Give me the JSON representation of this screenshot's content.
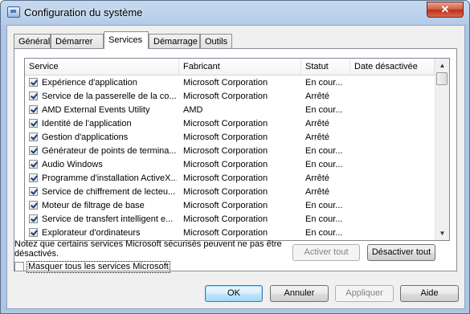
{
  "window": {
    "title": "Configuration du système",
    "close_glyph": "✕"
  },
  "tabs": [
    {
      "label": "Général"
    },
    {
      "label": "Démarrer"
    },
    {
      "label": "Services"
    },
    {
      "label": "Démarrage"
    },
    {
      "label": "Outils"
    }
  ],
  "active_tab": "Services",
  "columns": {
    "service": "Service",
    "manufacturer": "Fabricant",
    "status": "Statut",
    "disabled_date": "Date désactivée"
  },
  "services": [
    {
      "checked": true,
      "name": "Expérience d'application",
      "manufacturer": "Microsoft Corporation",
      "status": "En cour...",
      "date": ""
    },
    {
      "checked": true,
      "name": "Service de la passerelle de la co...",
      "manufacturer": "Microsoft Corporation",
      "status": "Arrêté",
      "date": ""
    },
    {
      "checked": true,
      "name": "AMD External Events Utility",
      "manufacturer": "AMD",
      "status": "En cour...",
      "date": ""
    },
    {
      "checked": true,
      "name": "Identité de l'application",
      "manufacturer": "Microsoft Corporation",
      "status": "Arrêté",
      "date": ""
    },
    {
      "checked": true,
      "name": "Gestion d'applications",
      "manufacturer": "Microsoft Corporation",
      "status": "Arrêté",
      "date": ""
    },
    {
      "checked": true,
      "name": "Générateur de points de termina...",
      "manufacturer": "Microsoft Corporation",
      "status": "En cour...",
      "date": ""
    },
    {
      "checked": true,
      "name": "Audio Windows",
      "manufacturer": "Microsoft Corporation",
      "status": "En cour...",
      "date": ""
    },
    {
      "checked": true,
      "name": "Programme d'installation ActiveX...",
      "manufacturer": "Microsoft Corporation",
      "status": "Arrêté",
      "date": ""
    },
    {
      "checked": true,
      "name": "Service de chiffrement de lecteu...",
      "manufacturer": "Microsoft Corporation",
      "status": "Arrêté",
      "date": ""
    },
    {
      "checked": true,
      "name": "Moteur de filtrage de base",
      "manufacturer": "Microsoft Corporation",
      "status": "En cour...",
      "date": ""
    },
    {
      "checked": true,
      "name": "Service de transfert intelligent e...",
      "manufacturer": "Microsoft Corporation",
      "status": "En cour...",
      "date": ""
    },
    {
      "checked": true,
      "name": "Explorateur d'ordinateurs",
      "manufacturer": "Microsoft Corporation",
      "status": "En cour...",
      "date": ""
    }
  ],
  "note": "Notez que certains services Microsoft sécurisés peuvent ne pas être désactivés.",
  "buttons": {
    "enable_all": "Activer tout",
    "disable_all": "Désactiver tout",
    "ok": "OK",
    "cancel": "Annuler",
    "apply": "Appliquer",
    "help": "Aide"
  },
  "hide_ms": {
    "label": "Masquer tous les services Microsoft",
    "checked": false
  },
  "icons": {
    "scroll_up": "▲",
    "scroll_down": "▼"
  },
  "colors": {
    "title_bar": "#b3cbe8",
    "close_button": "#cf5a3d",
    "default_button_border": "#3c7fb1"
  }
}
